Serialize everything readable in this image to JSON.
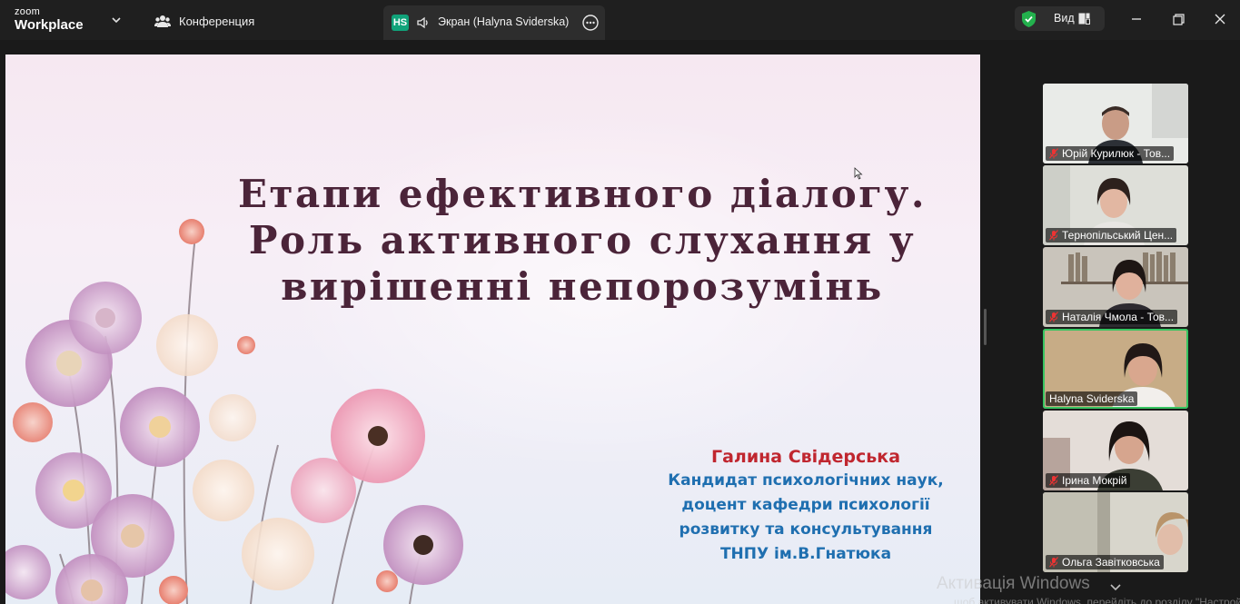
{
  "app": {
    "logo_line1": "zoom",
    "logo_line2": "Workplace"
  },
  "titlebar": {
    "conference_label": "Конференция",
    "screen_badge": "HS",
    "screen_tab_label": "Экран (Halyna Sviderska)",
    "view_label": "Вид"
  },
  "slide": {
    "title_lines": [
      "Етапи ефективного діалогу.",
      "Роль активного слухання у",
      "вирішенні непорозумінь"
    ],
    "author_name": "Галина Свідерська",
    "author_lines": [
      "Кандидат психологічних наук,",
      "доцент кафедри психології",
      "розвитку та консультування",
      "ТНПУ ім.В.Гнатюка"
    ]
  },
  "participants": [
    {
      "name": "Юрій Курилюк - Тов...",
      "muted": true,
      "active": false
    },
    {
      "name": "Тернопільський Цен...",
      "muted": true,
      "active": false
    },
    {
      "name": "Наталія Чмола - Тов...",
      "muted": true,
      "active": false
    },
    {
      "name": "Halyna Sviderska",
      "muted": false,
      "active": true
    },
    {
      "name": "Ірина Мокрій",
      "muted": true,
      "active": false
    },
    {
      "name": "Ольга Завітковська",
      "muted": true,
      "active": false
    }
  ],
  "watermark": {
    "title": "Активація Windows",
    "subtitle": "...щоб активувати Windows, перейдіть до розділу \"Настройки\"."
  },
  "colors": {
    "accent_green": "#37c461",
    "badge_green": "#10a37a",
    "title_color": "#4b2439",
    "author_name_color": "#c0262f",
    "author_text_color": "#1f6fb0"
  }
}
